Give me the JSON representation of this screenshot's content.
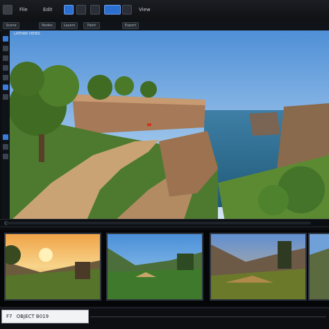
{
  "toolbar": {
    "menu_1": "File",
    "menu_2": "Edit",
    "menu_3": "View",
    "icons": [
      "view-icon",
      "render-icon",
      "grid-icon",
      "camera-icon",
      "settings-icon"
    ]
  },
  "tabs": [
    "Scene",
    "Nodes",
    "Layers",
    "Paint",
    "Export"
  ],
  "viewport": {
    "title": "LATHAN VIEWS"
  },
  "thumbnails": [
    {
      "name": "sunset-meadow"
    },
    {
      "name": "valley-day"
    },
    {
      "name": "mountain-dusk"
    },
    {
      "name": "ridge"
    }
  ],
  "status": {
    "label": "F7",
    "text": "OBJECT B019"
  },
  "colors": {
    "accent": "#2b6fd1",
    "sky": "#7fb4e6",
    "sea": "#2f6f8f"
  }
}
